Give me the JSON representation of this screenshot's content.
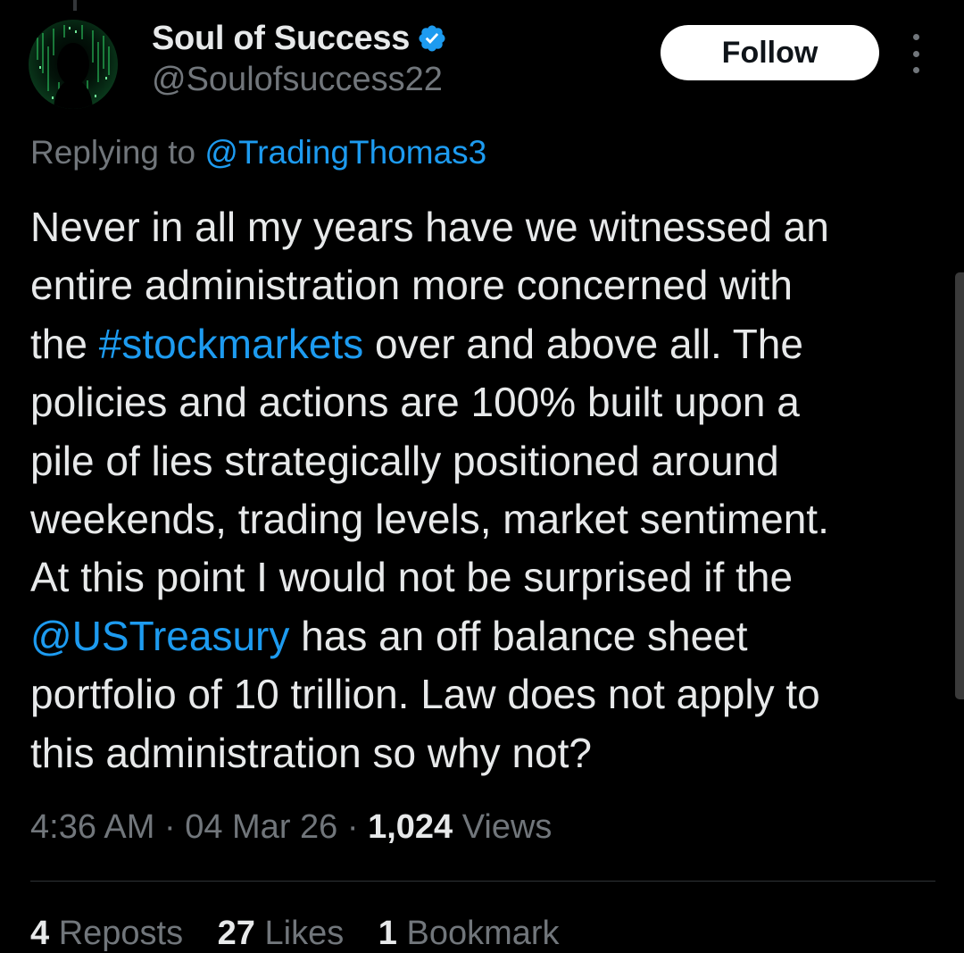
{
  "author": {
    "display_name": "Soul of Success",
    "handle": "@Soulofsuccess22",
    "verified": true
  },
  "actions": {
    "follow_label": "Follow"
  },
  "reply_context": {
    "prefix": "Replying to",
    "mention": "@TradingThomas3"
  },
  "tweet": {
    "lines": [
      [
        {
          "text": "Never in all my years have we witnessed an",
          "type": "text"
        }
      ],
      [
        {
          "text": "entire administration more concerned with",
          "type": "text"
        }
      ],
      [
        {
          "text": "the ",
          "type": "text"
        },
        {
          "text": "#stockmarkets",
          "type": "hashtag"
        },
        {
          "text": " over and above all. The",
          "type": "text"
        }
      ],
      [
        {
          "text": "policies and actions are 100% built upon a",
          "type": "text"
        }
      ],
      [
        {
          "text": "pile of lies strategically positioned around",
          "type": "text"
        }
      ],
      [
        {
          "text": "weekends, trading levels, market sentiment.",
          "type": "text"
        }
      ],
      [
        {
          "text": "At this point I would not be surprised if the",
          "type": "text"
        }
      ],
      [
        {
          "text": "@USTreasury",
          "type": "mention"
        },
        {
          "text": " has an off balance sheet",
          "type": "text"
        }
      ],
      [
        {
          "text": "portfolio of 10 trillion. Law does not apply to",
          "type": "text"
        }
      ],
      [
        {
          "text": "this administration so why not?",
          "type": "text"
        }
      ]
    ]
  },
  "meta": {
    "time": "4:36 AM",
    "separator": " · ",
    "date": "04 Mar 26",
    "views_count": "1,024",
    "views_label": " Views"
  },
  "stats": [
    {
      "count": "4",
      "label": " Reposts"
    },
    {
      "count": "27",
      "label": " Likes"
    },
    {
      "count": "1",
      "label": " Bookmark"
    }
  ],
  "colors": {
    "background": "#000000",
    "text_primary": "#e7e9ea",
    "text_secondary": "#71767b",
    "link": "#1d9bf0",
    "verified_badge": "#1d9bf0"
  }
}
